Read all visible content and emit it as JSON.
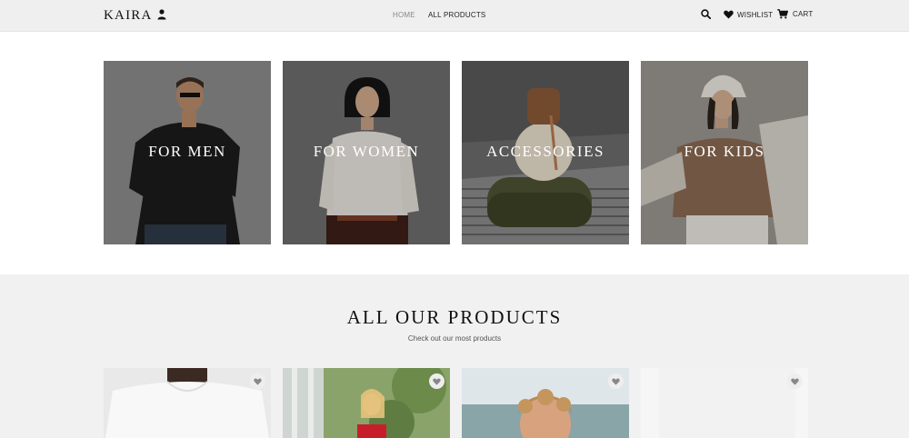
{
  "header": {
    "logo": "KAIRA",
    "nav": {
      "home": "HOME",
      "all_products": "ALL PRODUCTS"
    },
    "wishlist_label": "WISHLIST",
    "cart_label": "CART",
    "icons": [
      "user-icon",
      "search-icon",
      "heart-icon",
      "cart-icon"
    ]
  },
  "categories": [
    {
      "label": "FOR MEN",
      "image": "man-in-black-tshirt"
    },
    {
      "label": "FOR WOMEN",
      "image": "woman-in-white-top"
    },
    {
      "label": "ACCESSORIES",
      "image": "bag-on-stand"
    },
    {
      "label": "FOR KIDS",
      "image": "girl-in-bucket-hat"
    }
  ],
  "products_section": {
    "title": "ALL OUR PRODUCTS",
    "subtitle": "Check out our most products",
    "items": [
      {
        "image": "man-white-tshirt",
        "wishlist_icon": "heart-icon"
      },
      {
        "image": "woman-red-top-outdoor",
        "wishlist_icon": "heart-icon"
      },
      {
        "image": "curly-hair-man",
        "wishlist_icon": "heart-icon"
      },
      {
        "image": "light-background",
        "wishlist_icon": "heart-icon"
      }
    ]
  },
  "colors": {
    "header_bg": "#efefef",
    "section_bg": "#f1f1f1",
    "text": "#111111",
    "muted": "#888888"
  }
}
